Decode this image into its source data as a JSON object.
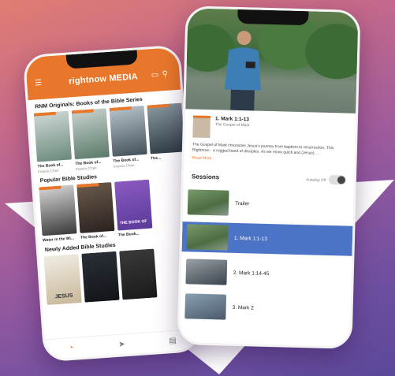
{
  "left_phone": {
    "app_logo": "rightnow MEDIA",
    "sections": [
      {
        "title": "RNM Originals: Books of the Bible Series",
        "cards": [
          {
            "title": "",
            "name": "The Book of...",
            "author": "Francis Chan",
            "colors": [
              "#cfd8d6",
              "#6a8a7c"
            ]
          },
          {
            "title": "",
            "name": "The Book of...",
            "author": "Francis Chan",
            "colors": [
              "#c8d2cc",
              "#5a7a6a"
            ]
          },
          {
            "title": "",
            "name": "The Book of...",
            "author": "Francis Chan",
            "colors": [
              "#b9c4cc",
              "#44505a"
            ]
          },
          {
            "title": "",
            "name": "The...",
            "author": "",
            "colors": [
              "#8a9aa0",
              "#2a3a40"
            ]
          }
        ]
      },
      {
        "title": "Popular Bible Studies",
        "cards": [
          {
            "title": "",
            "name": "Water in the Wi...",
            "author": "",
            "colors": [
              "#d6d6d6",
              "#3a3a3a"
            ]
          },
          {
            "title": "",
            "name": "The Book of...",
            "author": "",
            "colors": [
              "#6a5a4a",
              "#2a2220"
            ]
          },
          {
            "title": "THE BOOK OF",
            "name": "The Book...",
            "author": "",
            "colors": [
              "#8a5ac0",
              "#5a3a9a"
            ]
          }
        ]
      },
      {
        "title": "Newly Added Bible Studies",
        "cards": [
          {
            "title": "JESUS",
            "name": "",
            "author": "",
            "colors": [
              "#f0ece4",
              "#c9b89a"
            ]
          },
          {
            "title": "",
            "name": "",
            "author": "",
            "colors": [
              "#2a3038",
              "#121418"
            ]
          },
          {
            "title": "",
            "name": "",
            "author": "",
            "colors": [
              "#3a3a3a",
              "#1a1a1a"
            ]
          }
        ]
      }
    ]
  },
  "right_phone": {
    "book_title": "1. Mark 1:1-13",
    "book_subtitle": "The Gospel of Mark",
    "description": "The Gospel of Mark chronicles Jesus's journey from baptism to resurrection. This Rightnow... a rugged band of disciples. As we move quick and (Jesus) ...",
    "read_more": "Read More",
    "sessions_header": "Sessions",
    "autoplay_label": "Autoplay Off",
    "sessions": [
      {
        "label": "Trailer",
        "active": false
      },
      {
        "label": "1. Mark 1:1-13",
        "active": true
      },
      {
        "label": "2. Mark 1:14-45",
        "active": false
      },
      {
        "label": "3. Mark 2",
        "active": false
      }
    ]
  },
  "colors": {
    "accent": "#e8772b",
    "active_session": "#4b73c6"
  }
}
